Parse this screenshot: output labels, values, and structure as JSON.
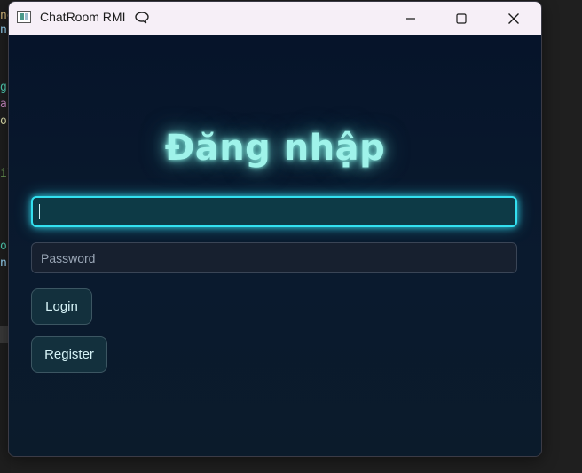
{
  "window": {
    "title": "ChatRoom RMI",
    "controls": {
      "minimize_icon": "minimize-icon",
      "maximize_icon": "maximize-icon",
      "close_icon": "close-icon"
    }
  },
  "form": {
    "heading": "Đăng nhập",
    "username": {
      "value": "",
      "placeholder": ""
    },
    "password": {
      "value": "",
      "placeholder": "Password"
    },
    "login_label": "Login",
    "register_label": "Register"
  },
  "colors": {
    "heading_glow": "#9ff3ea",
    "focus_border": "#33e0f0",
    "client_background": "#0a1a2e",
    "titlebar": "#f6eff7"
  },
  "background_editor": {
    "fragments": [
      "ne",
      "n",
      "",
      "g",
      "a",
      "ou",
      "",
      "il",
      "",
      "ou",
      "n"
    ]
  }
}
